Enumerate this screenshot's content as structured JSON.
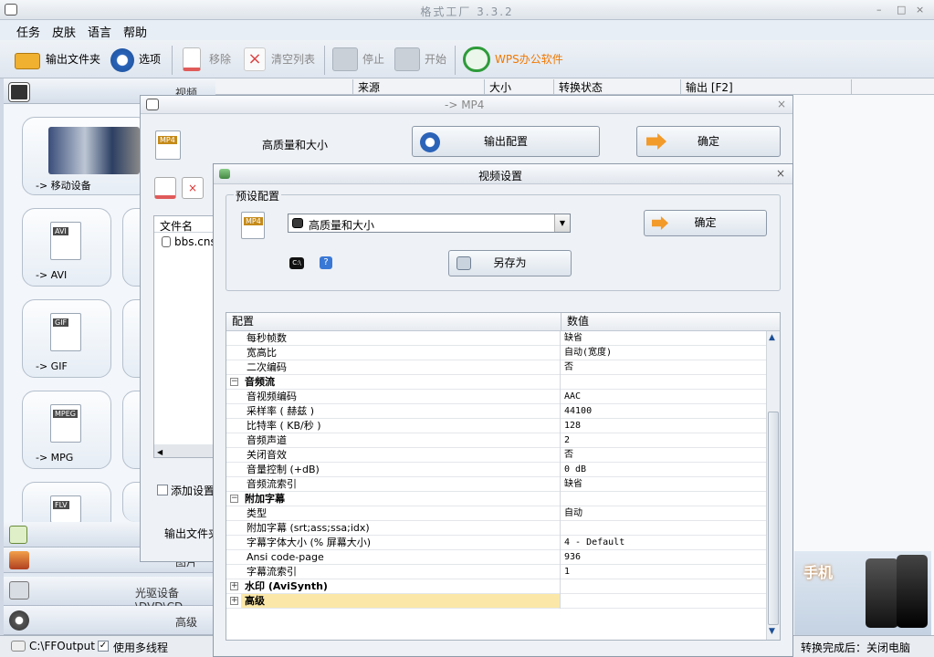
{
  "app": {
    "title": "格式工厂 3.3.2",
    "window_controls": [
      "–",
      "□",
      "×"
    ]
  },
  "menu": [
    "任务",
    "皮肤",
    "语言",
    "帮助"
  ],
  "toolbar": {
    "output_folder": "输出文件夹",
    "options": "选项",
    "remove": "移除",
    "clear_list": "清空列表",
    "stop": "停止",
    "start": "开始",
    "wps": "WPS办公软件",
    "accent": "#f07800"
  },
  "grid_header": [
    "来源",
    "大小",
    "转换状态",
    "输出 [F2]"
  ],
  "left": {
    "video_cat": "视频",
    "tiles": [
      {
        "label": "-> 移动设备",
        "icon": "phones-icon"
      },
      {
        "label": "-> AVI",
        "tag": "AVI"
      },
      {
        "label": "-> GIF",
        "tag": "GIF"
      },
      {
        "label": "-> MPG",
        "tag": "MPEG"
      },
      {
        "label": "",
        "tag": "FLV"
      }
    ],
    "image_cat": "图片",
    "disc_cat": "光驱设备\\DVD\\CD",
    "advanced_cat": "高级"
  },
  "mp4_dialog": {
    "title": "-> MP4",
    "icon_tag": "MP4",
    "quality": "高质量和大小",
    "output_config": "输出配置",
    "ok": "确定",
    "filename_header": "文件名",
    "file": "bbs.cnsc",
    "add_settings": "添加设置",
    "output_folder": "输出文件夹"
  },
  "video_dialog": {
    "title": "视频设置",
    "preset_group": "预设配置",
    "preset_value": "高质量和大小",
    "ok": "确定",
    "save_as": "另存为",
    "help": "?",
    "cmd": "C:\\",
    "col_config": "配置",
    "col_value": "数值",
    "rows": [
      {
        "k": "每秒帧数",
        "v": "缺省"
      },
      {
        "k": "宽高比",
        "v": "自动(宽度)"
      },
      {
        "k": "二次编码",
        "v": "否"
      },
      {
        "k": "音频流",
        "v": "",
        "group": true,
        "sign": "−"
      },
      {
        "k": "音视频编码",
        "v": "AAC"
      },
      {
        "k": "采样率 ( 赫兹 )",
        "v": "44100"
      },
      {
        "k": "比特率 ( KB/秒 )",
        "v": "128"
      },
      {
        "k": "音频声道",
        "v": "2"
      },
      {
        "k": "关闭音效",
        "v": "否"
      },
      {
        "k": "音量控制 (+dB)",
        "v": "0 dB"
      },
      {
        "k": "音频流索引",
        "v": "缺省"
      },
      {
        "k": "附加字幕",
        "v": "",
        "group": true,
        "sign": "−"
      },
      {
        "k": "类型",
        "v": "自动"
      },
      {
        "k": "附加字幕 (srt;ass;ssa;idx)",
        "v": ""
      },
      {
        "k": "字幕字体大小 (% 屏幕大小)",
        "v": "4 - Default"
      },
      {
        "k": "Ansi code-page",
        "v": "936"
      },
      {
        "k": "字幕流索引",
        "v": "1"
      },
      {
        "k": "水印 (AviSynth)",
        "v": "",
        "group": true,
        "sign": "+"
      },
      {
        "k": "高级",
        "v": "",
        "group": true,
        "sign": "+",
        "selected": true
      }
    ]
  },
  "status": {
    "path": "C:\\FFOutput",
    "multithread": "使用多线程",
    "after": "转换完成后：关闭电脑"
  },
  "ad": {
    "text": "手机"
  }
}
